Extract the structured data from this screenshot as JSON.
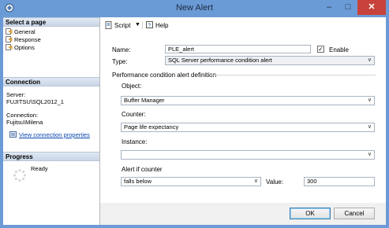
{
  "window": {
    "title": "New Alert"
  },
  "sidebar": {
    "select_page_heading": "Select a page",
    "pages": [
      {
        "label": "General"
      },
      {
        "label": "Response"
      },
      {
        "label": "Options"
      }
    ],
    "connection_heading": "Connection",
    "server_label": "Server:",
    "server_value": "FUJITSU\\SQL2012_1",
    "connection_label": "Connection:",
    "connection_value": "Fujitsu\\Milena",
    "view_connection_link": "View connection properties",
    "progress_heading": "Progress",
    "progress_status": "Ready"
  },
  "toolbar": {
    "script_label": "Script",
    "help_label": "Help"
  },
  "form": {
    "name_label": "Name:",
    "name_value": "PLE_alert",
    "enable_label": "Enable",
    "enable_checked": true,
    "type_label": "Type:",
    "type_value": "SQL Server performance condition alert",
    "definition_heading": "Performance condition alert definition",
    "object_label": "Object:",
    "object_value": "Buffer Manager",
    "counter_label": "Counter:",
    "counter_value": "Page life expectancy",
    "instance_label": "Instance:",
    "instance_value": "",
    "alert_if_label": "Alert if counter",
    "alert_if_value": "falls below",
    "value_label": "Value:",
    "value_value": "300"
  },
  "footer": {
    "ok_label": "OK",
    "cancel_label": "Cancel"
  },
  "colors": {
    "titlebar": "#6b9bd6",
    "close_button": "#c7423b",
    "link": "#0645ad"
  }
}
